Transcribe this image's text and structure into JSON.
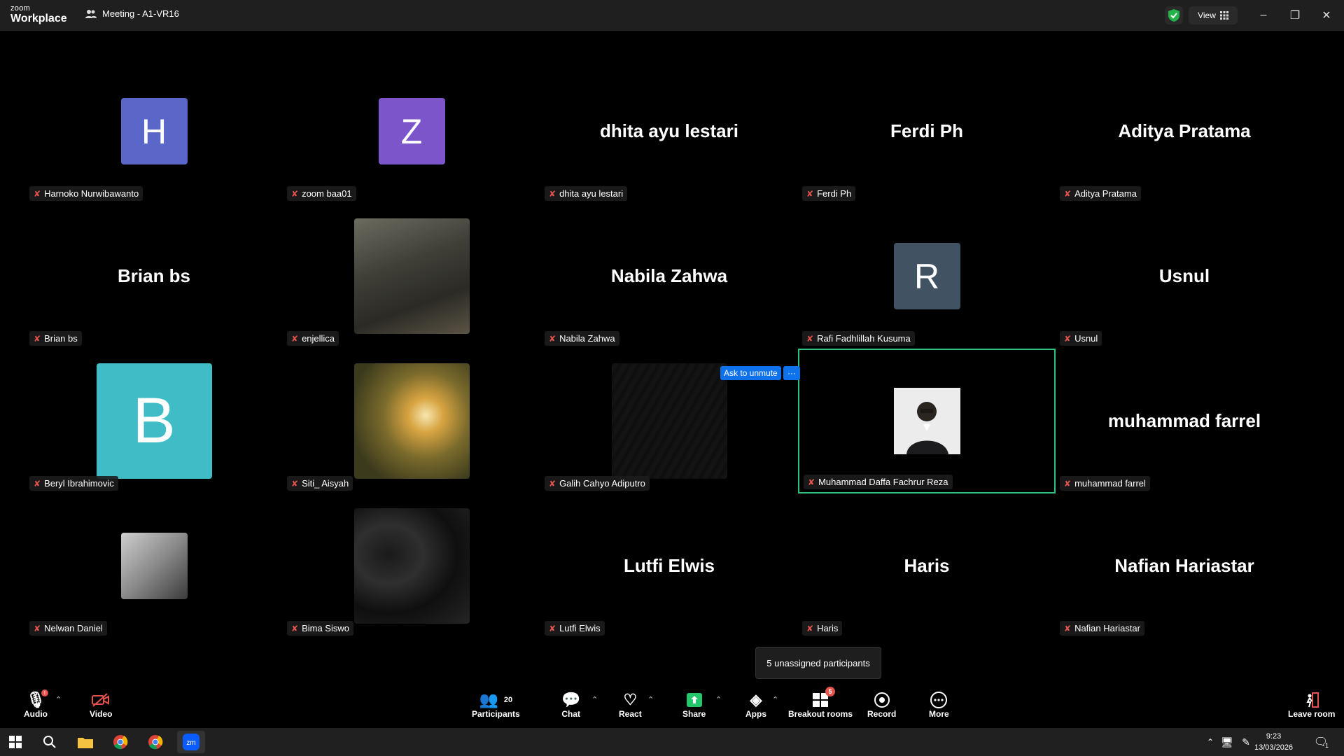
{
  "titlebar": {
    "logo_top": "zoom",
    "logo_bottom": "Workplace",
    "meeting_title": "Meeting - A1-VR16",
    "view_label": "View"
  },
  "tiles": [
    {
      "name": "Harnoko Nurwibawanto",
      "display": "letter",
      "letter": "H",
      "color": "#5a67c8"
    },
    {
      "name": "zoom baa01",
      "display": "letter",
      "letter": "Z",
      "color": "#7b55c9"
    },
    {
      "name": "dhita ayu lestari",
      "display": "name",
      "big_name": "dhita ayu lestari"
    },
    {
      "name": "Ferdi Ph",
      "display": "name",
      "big_name": "Ferdi Ph"
    },
    {
      "name": "Aditya Pratama",
      "display": "name",
      "big_name": "Aditya Pratama"
    },
    {
      "name": "Brian bs",
      "display": "name",
      "big_name": "Brian bs"
    },
    {
      "name": "enjellica",
      "display": "photo"
    },
    {
      "name": "Nabila Zahwa",
      "display": "name",
      "big_name": "Nabila Zahwa"
    },
    {
      "name": "Rafi Fadhlillah Kusuma",
      "display": "letter",
      "letter": "R",
      "color": "#415262"
    },
    {
      "name": "Usnul",
      "display": "name",
      "big_name": "Usnul"
    },
    {
      "name": "Beryl Ibrahimovic",
      "display": "letter-big",
      "letter": "B",
      "color": "#3fbcc6"
    },
    {
      "name": "Siti_ Aisyah",
      "display": "photo"
    },
    {
      "name": "Galih Cahyo Adiputro",
      "display": "photo"
    },
    {
      "name": "Muhammad Daffa Fachrur Reza",
      "display": "photo-sm",
      "active": true
    },
    {
      "name": "muhammad farrel",
      "display": "name",
      "big_name": "muhammad farrel"
    },
    {
      "name": "Nelwan Daniel",
      "display": "photo-sm"
    },
    {
      "name": "Bima Siswo",
      "display": "photo"
    },
    {
      "name": "Lutfi Elwis",
      "display": "name",
      "big_name": "Lutfi Elwis"
    },
    {
      "name": "Haris",
      "display": "name",
      "big_name": "Haris"
    },
    {
      "name": "Nafian Hariastar",
      "display": "name",
      "big_name": "Nafian Hariastar"
    }
  ],
  "overlay": {
    "ask_to_unmute": "Ask to unmute",
    "more_dots": "···",
    "tooltip": "5 unassigned participants"
  },
  "toolbar": {
    "audio": "Audio",
    "video": "Video",
    "participants": "Participants",
    "participants_count": "20",
    "chat": "Chat",
    "react": "React",
    "share": "Share",
    "apps": "Apps",
    "breakout": "Breakout rooms",
    "breakout_badge": "5",
    "record": "Record",
    "more": "More",
    "leave": "Leave room"
  },
  "taskbar": {
    "time": "9:23",
    "date": "13/03/2026",
    "notif_count": "1"
  }
}
